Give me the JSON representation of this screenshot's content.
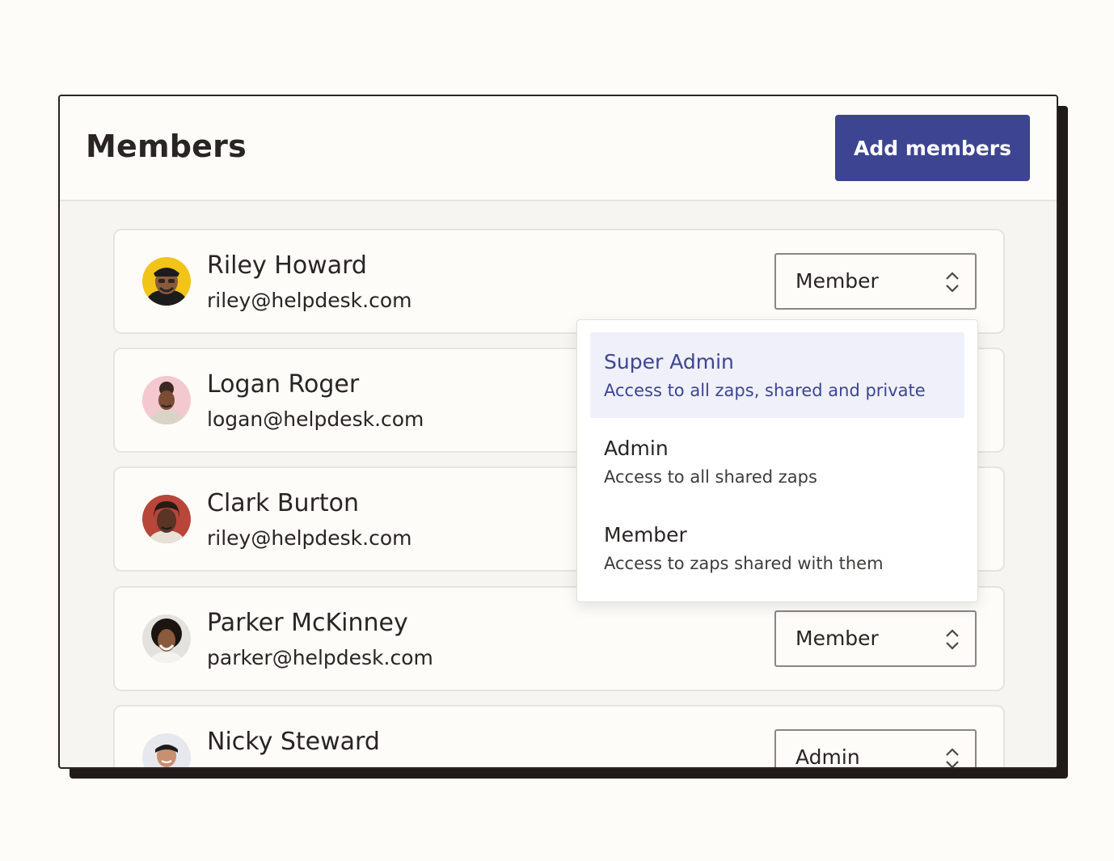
{
  "header": {
    "title": "Members",
    "add_button_label": "Add members"
  },
  "members": [
    {
      "name": "Riley Howard",
      "email": "riley@helpdesk.com",
      "role": "Member"
    },
    {
      "name": "Logan Roger",
      "email": "logan@helpdesk.com",
      "role": ""
    },
    {
      "name": "Clark Burton",
      "email": "riley@helpdesk.com",
      "role": ""
    },
    {
      "name": "Parker McKinney",
      "email": "parker@helpdesk.com",
      "role": "Member"
    },
    {
      "name": "Nicky Steward",
      "email": "",
      "role": "Admin"
    }
  ],
  "role_menu": {
    "selected": "Super Admin",
    "options": [
      {
        "title": "Super Admin",
        "description": "Access to all zaps, shared and private"
      },
      {
        "title": "Admin",
        "description": "Access to all shared zaps"
      },
      {
        "title": "Member",
        "description": "Access to zaps shared with them"
      }
    ]
  },
  "colors": {
    "accent": "#3d4592",
    "highlight": "#eff0fa",
    "page_background": "#fdfcf8",
    "card_shadow": "#201a18"
  },
  "icons": {
    "select_caret": "chevron-up-down-icon"
  }
}
